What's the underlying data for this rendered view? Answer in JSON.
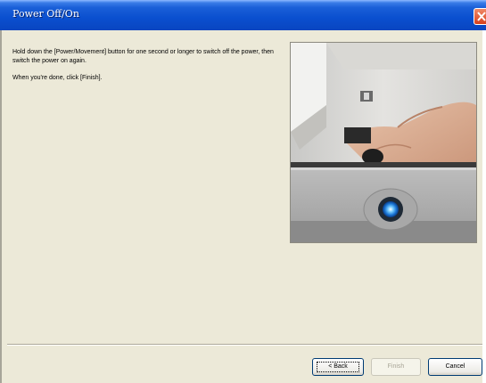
{
  "window": {
    "title": "Power Off/On"
  },
  "instructions": {
    "line1": "Hold down the [Power/Movement] button for one second or longer to switch off the power, then switch the power on again.",
    "line2": "When you're done, click [Finish]."
  },
  "photo": {
    "icon": "printer-power-button-photo"
  },
  "buttons": {
    "back": "< Back",
    "finish": "Finish",
    "cancel": "Cancel"
  },
  "colors": {
    "titlebar": "#0a4fcf",
    "dialog_bg": "#ece9d8",
    "close": "#d8401c"
  }
}
